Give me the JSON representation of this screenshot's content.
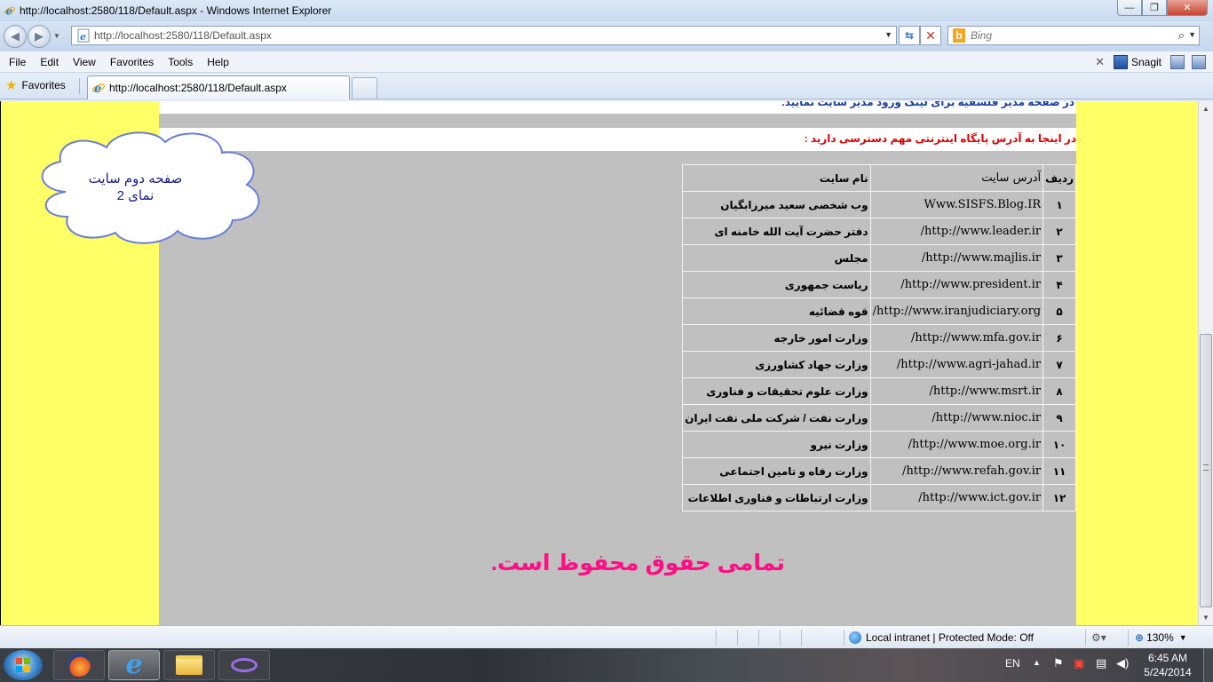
{
  "window": {
    "title": "http://localhost:2580/118/Default.aspx - Windows Internet Explorer",
    "buttons": {
      "minimize": "—",
      "maximize": "❐",
      "close": "✕"
    }
  },
  "address": {
    "url": "http://localhost:2580/118/Default.aspx",
    "search_placeholder": "Bing"
  },
  "menu": {
    "items": [
      "File",
      "Edit",
      "View",
      "Favorites",
      "Tools",
      "Help"
    ],
    "snagit_label": "Snagit"
  },
  "favorites": {
    "label": "Favorites",
    "tab_title": "http://localhost:2580/118/Default.aspx"
  },
  "page": {
    "cut_heading": "در صفحه مدیر فلسفیه برای لینک ورود مدیر سایت نمایید.",
    "intro": "در اینجا به آدرس پایگاه اینترنتی مهم دسترسی دارید :",
    "cloud_line1": "صفحه دوم سایت",
    "cloud_line2": "نمای 2",
    "table": {
      "headers": {
        "row": "ردیف",
        "address": "آدرس سایت",
        "name": "نام سایت"
      },
      "rows": [
        {
          "num": "۱",
          "address": "Www.SISFS.Blog.IR",
          "name": "وب شخصی سعید میرزابگیان"
        },
        {
          "num": "۲",
          "address": "http://www.leader.ir/",
          "name": "دفتر حضرت آیت الله خامنه ای"
        },
        {
          "num": "۳",
          "address": "http://www.majlis.ir/",
          "name": "مجلس"
        },
        {
          "num": "۴",
          "address": "http://www.president.ir/",
          "name": "ریاست جمهوری"
        },
        {
          "num": "۵",
          "address": "http://www.iranjudiciary.org/",
          "name": "قوه قضائیه"
        },
        {
          "num": "۶",
          "address": "http://www.mfa.gov.ir/",
          "name": "وزارت امور خارجه"
        },
        {
          "num": "۷",
          "address": "http://www.agri-jahad.ir/",
          "name": "وزارت جهاد کشاورزی"
        },
        {
          "num": "۸",
          "address": "http://www.msrt.ir/",
          "name": "وزارت علوم تحقیقات و فناوری"
        },
        {
          "num": "۹",
          "address": "http://www.nioc.ir/",
          "name": "وزارت نفت / شرکت ملی نفت ایران"
        },
        {
          "num": "۱۰",
          "address": "http://www.moe.org.ir/",
          "name": "وزارت نیرو"
        },
        {
          "num": "۱۱",
          "address": "http://www.refah.gov.ir/",
          "name": "وزارت رفاه و تامین اجتماعی"
        },
        {
          "num": "۱۲",
          "address": "http://www.ict.gov.ir/",
          "name": "وزارت ارتباطات و فناوری اطلاعات"
        }
      ]
    },
    "footer": "تمامی حقوق محفوظ است."
  },
  "status": {
    "zone": "Local intranet | Protected Mode: Off",
    "zoom": "130%"
  },
  "taskbar": {
    "language": "EN",
    "time": "6:45 AM",
    "date": "5/24/2014"
  },
  "colors": {
    "page_side": "#ffff66",
    "page_main": "#c0c0c0",
    "intro_text": "#e00000",
    "footer_text": "#ff0d84",
    "cloud_text": "#1a1a8c"
  },
  "icons": {
    "back": "back-arrow-icon",
    "forward": "forward-arrow-icon",
    "refresh": "refresh-icon",
    "stop": "stop-icon",
    "search": "magnifier-icon",
    "favorites": "star-icon",
    "zone": "globe-icon",
    "zoom": "zoom-icon"
  }
}
